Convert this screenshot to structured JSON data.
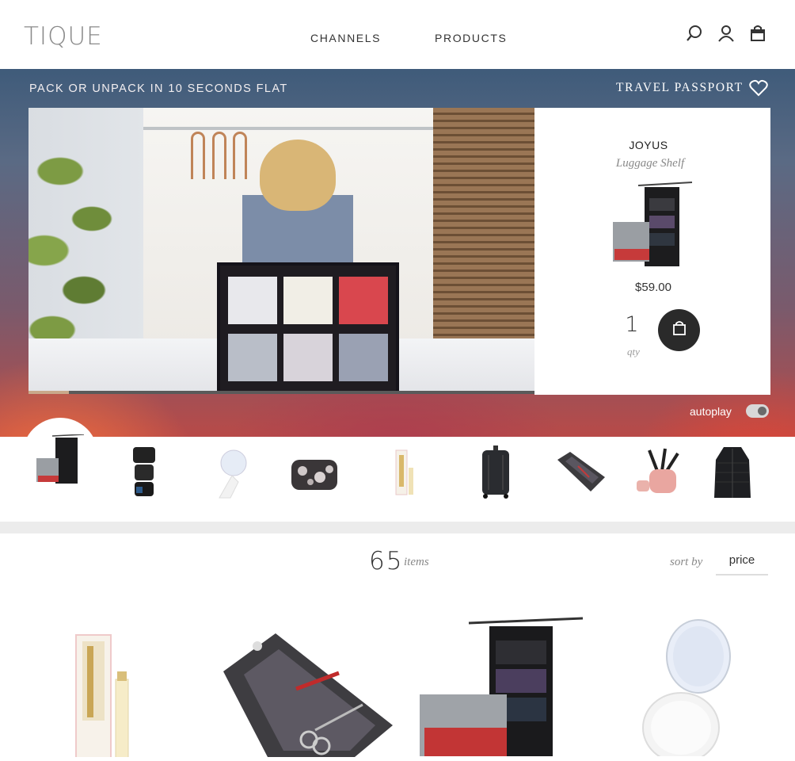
{
  "header": {
    "logo": "TIQUE",
    "nav": [
      "CHANNELS",
      "PRODUCTS"
    ],
    "icons": [
      "search-icon",
      "user-icon",
      "shopping-bag-icon"
    ]
  },
  "hero": {
    "tagline": "PACK OR UNPACK IN 10 SECONDS FLAT",
    "channel": "TRAVEL PASSPORT",
    "video_progress_pct": 8,
    "product": {
      "brand": "JOYUS",
      "name": "Luggage Shelf",
      "price": "$59.00",
      "qty": "1",
      "qty_label": "qty"
    },
    "autoplay_label": "autoplay",
    "autoplay_on": true
  },
  "thumbnails": [
    "luggage-shelf",
    "packing-cubes",
    "folding-mirror",
    "floral-cosmetic-case",
    "bling-brush",
    "carry-on-suitcase",
    "manicure-roll-case",
    "pink-brush-holder",
    "puffer-jacket"
  ],
  "listing": {
    "count": "65",
    "count_label": "items",
    "sort_label": "sort by",
    "sort_value": "price",
    "items": [
      "bling-brush",
      "manicure-roll-case",
      "luggage-shelf",
      "folding-mirror"
    ]
  },
  "colors": {
    "accent": "#2a2a2a",
    "hero_top": "#3f5b7a",
    "hero_bottom": "#b84a48"
  }
}
